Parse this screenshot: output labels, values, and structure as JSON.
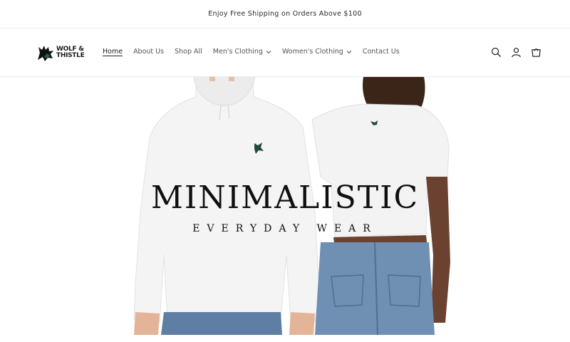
{
  "announcement": {
    "text": "Enjoy Free Shipping on Orders Above $100"
  },
  "brand": {
    "line1": "WOLF &",
    "line2": "THISTLE"
  },
  "nav": {
    "items": [
      {
        "label": "Home",
        "active": true,
        "dropdown": false
      },
      {
        "label": "About Us",
        "active": false,
        "dropdown": false
      },
      {
        "label": "Shop All",
        "active": false,
        "dropdown": false
      },
      {
        "label": "Men's Clothing",
        "active": false,
        "dropdown": true
      },
      {
        "label": "Women's Clothing",
        "active": false,
        "dropdown": true
      },
      {
        "label": "Contact Us",
        "active": false,
        "dropdown": false
      }
    ]
  },
  "header_icons": [
    "search-icon",
    "account-icon",
    "cart-icon"
  ],
  "hero": {
    "title": "MINIMALISTIC",
    "subtitle": "EVERYDAY WEAR"
  },
  "colors": {
    "logo_green": "#1f4a3a",
    "denim": "#5e7fa3",
    "skin_dark": "#5a3826",
    "skin_light": "#d9a98a"
  }
}
